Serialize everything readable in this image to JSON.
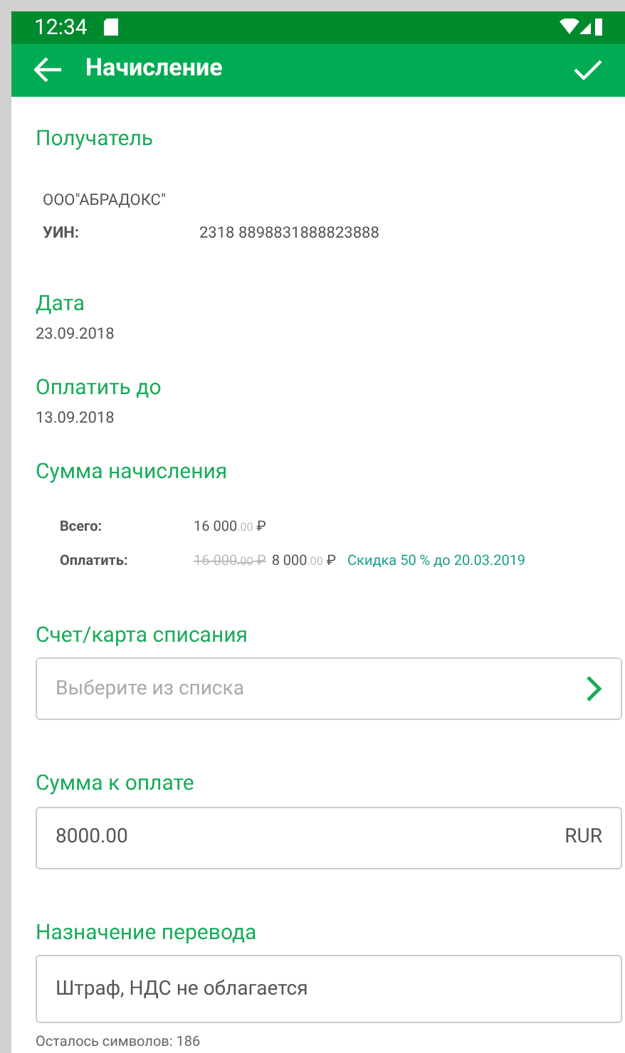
{
  "status_bar": {
    "time": "12:34"
  },
  "app_bar": {
    "title": "Начисление"
  },
  "recipient": {
    "label": "Получатель",
    "name": "ООО\"АБРАДОКС\"",
    "uin_label": "УИН:",
    "uin": "2318 8898831888823888"
  },
  "date": {
    "label": "Дата",
    "value": "23.09.2018"
  },
  "due": {
    "label": "Оплатить до",
    "value": "13.09.2018"
  },
  "amount": {
    "label": "Сумма начисления",
    "total": {
      "label": "Всего:",
      "main": "16 000",
      "cents": ".00",
      "currency": "₽"
    },
    "pay": {
      "label": "Оплатить:",
      "old_main": "16 000",
      "old_cents": ".00",
      "old_currency": "₽",
      "main": "8 000",
      "cents": ".00",
      "currency": "₽",
      "discount": "Скидка 50 % до 20.03.2019"
    }
  },
  "account": {
    "label": "Счет/карта списания",
    "placeholder": "Выберите из списка"
  },
  "sum": {
    "label": "Сумма к оплате",
    "value": "8000.00",
    "currency": "RUR"
  },
  "purpose": {
    "label": "Назначение перевода",
    "value": "Штраф, НДС не облагается",
    "hint": "Осталось символов: 186"
  }
}
